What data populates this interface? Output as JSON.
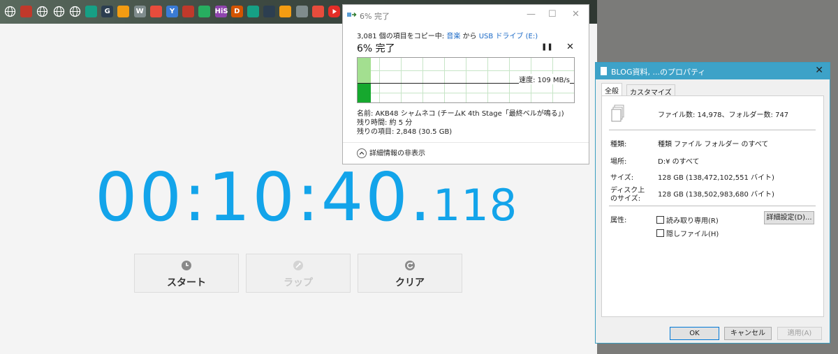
{
  "bookmarks": [
    {
      "icon": "globe-icon",
      "label": ""
    },
    {
      "icon": "cloud-icon",
      "label": ""
    },
    {
      "icon": "globe-icon",
      "label": ""
    },
    {
      "icon": "globe-icon",
      "label": ""
    },
    {
      "icon": "globe-icon",
      "label": ""
    },
    {
      "icon": "mask-icon",
      "label": ""
    },
    {
      "icon": "g-icon",
      "label": "G"
    },
    {
      "icon": "book-icon",
      "label": ""
    },
    {
      "icon": "w-icon",
      "label": "W"
    },
    {
      "icon": "image-icon",
      "label": ""
    },
    {
      "icon": "y-icon",
      "label": "Y"
    },
    {
      "icon": "film-icon",
      "label": ""
    },
    {
      "icon": "bookmark-icon",
      "label": ""
    },
    {
      "icon": "his-icon",
      "label": "HiS"
    },
    {
      "icon": "d-icon",
      "label": "D"
    },
    {
      "icon": "note-icon",
      "label": ""
    },
    {
      "icon": "gallery-icon",
      "label": ""
    },
    {
      "icon": "photo-icon",
      "label": ""
    },
    {
      "icon": "shield-icon",
      "label": ""
    },
    {
      "icon": "qr-icon",
      "label": ""
    },
    {
      "icon": "youtube-icon",
      "label": ""
    }
  ],
  "stopwatch": {
    "time_main": "00:10:40.",
    "time_ms": "118",
    "buttons": [
      {
        "label": "スタート",
        "icon": "clock-icon",
        "enabled": true
      },
      {
        "label": "ラップ",
        "icon": "pencil-icon",
        "enabled": false
      },
      {
        "label": "クリア",
        "icon": "refresh-icon",
        "enabled": true
      }
    ]
  },
  "copy_dialog": {
    "title": "6% 完了",
    "line_prefix": "3,081 個の項目をコピー中: ",
    "source": "音楽",
    "line_mid": " から ",
    "dest": "USB ドライブ (E:)",
    "percent_text": "6% 完了",
    "progress": 0.06,
    "speed": "速度: 109 MB/s",
    "name": "名前:  AKB48 シャムネコ (チームK 4th Stage「最終ベルが鳴る」)",
    "time_left": "残り時間:  約 5 分",
    "items_left": "残りの項目:  2,848 (30.5 GB)",
    "details_toggle": "詳細情報の非表示"
  },
  "properties": {
    "title": "BLOG資料, ...のプロパティ",
    "tabs": [
      "全般",
      "カスタマイズ"
    ],
    "summary": "ファイル数: 14,978、フォルダー数: 747",
    "rows": [
      {
        "label": "種類:",
        "value": "種類 ファイル フォルダー のすべて"
      },
      {
        "label": "場所:",
        "value": "D:¥ のすべて"
      },
      {
        "label": "サイズ:",
        "value": "128 GB (138,472,102,551 バイト)"
      },
      {
        "label_line1": "ディスク上",
        "label_line2": "のサイズ:",
        "value": "128 GB (138,502,983,680 バイト)"
      }
    ],
    "attributes_label": "属性:",
    "readonly_label": "読み取り専用(R)",
    "hidden_label": "隠しファイル(H)",
    "advanced_button": "詳細設定(D)...",
    "ok": "OK",
    "cancel": "キャンセル",
    "apply": "適用(A)"
  }
}
